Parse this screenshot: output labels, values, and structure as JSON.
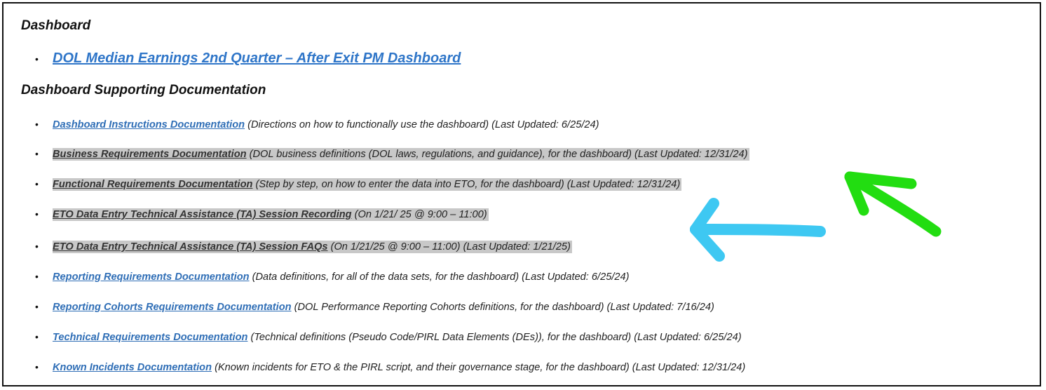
{
  "sections": [
    {
      "heading": "Dashboard",
      "items": [
        {
          "link": "DOL Median Earnings 2nd Quarter – After Exit PM Dashboard"
        }
      ]
    },
    {
      "heading": "Dashboard Supporting Documentation",
      "items": [
        {
          "link": "Dashboard Instructions Documentation",
          "desc": "(Directions on how to functionally use the dashboard) (Last Updated: 6/25/24)"
        },
        {
          "link": "Business Requirements Documentation",
          "desc": "(DOL business definitions (DOL laws, regulations, and guidance), for the dashboard) (Last Updated: 12/31/24)"
        },
        {
          "link": "Functional Requirements Documentation",
          "desc": "(Step by step, on how to enter the data into ETO, for the dashboard) (Last Updated: 12/31/24)"
        },
        {
          "link": "ETO Data Entry Technical Assistance (TA) Session Recording",
          "desc": "(On 1/21/ 25 @ 9:00 – 11:00)"
        },
        {
          "link": "ETO Data Entry Technical Assistance (TA) Session FAQs",
          "desc": "(On 1/21/25 @ 9:00 – 11:00) (Last Updated: 1/21/25)"
        },
        {
          "link": "Reporting Requirements Documentation",
          "desc": "(Data definitions, for all of the data sets, for the dashboard) (Last Updated: 6/25/24)"
        },
        {
          "link": "Reporting Cohorts Requirements Documentation",
          "desc": "(DOL Performance Reporting Cohorts definitions, for the dashboard) (Last Updated: 7/16/24)"
        },
        {
          "link": "Technical Requirements Documentation",
          "desc": "(Technical definitions (Pseudo Code/PIRL Data Elements (DEs)), for the dashboard) (Last Updated: 6/25/24)"
        },
        {
          "link": "Known Incidents Documentation",
          "desc": "(Known incidents for ETO & the PIRL script, and their governance stage, for the dashboard) (Last Updated: 12/31/24)"
        }
      ]
    }
  ],
  "colors": {
    "link": "#2f6eb6",
    "highlight": "#c8c8c8",
    "green_arrow": "#22dd11",
    "blue_arrow": "#3ec8f2"
  },
  "annotations": [
    {
      "name": "green-arrow",
      "color": "#22dd11"
    },
    {
      "name": "blue-arrow",
      "color": "#3ec8f2"
    }
  ]
}
